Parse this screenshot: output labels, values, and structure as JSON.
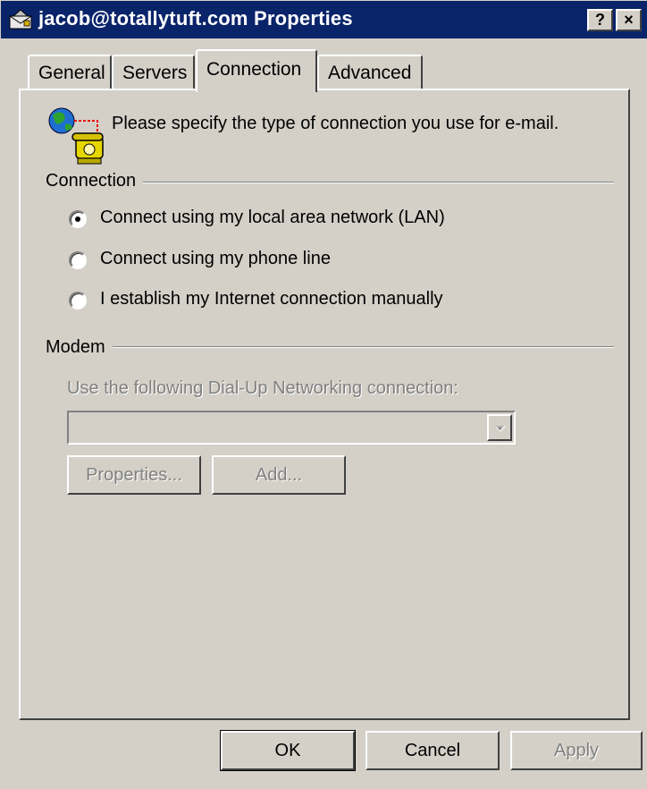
{
  "window": {
    "title": "jacob@totallytuft.com Properties",
    "help_label": "?",
    "close_label": "×"
  },
  "tabs": [
    {
      "label": "General",
      "selected": false
    },
    {
      "label": "Servers",
      "selected": false
    },
    {
      "label": "Connection",
      "selected": true
    },
    {
      "label": "Advanced",
      "selected": false
    }
  ],
  "connection_page": {
    "intro": "Please specify the type of connection you use for e-mail.",
    "connection_group": {
      "label": "Connection",
      "options": [
        {
          "label": "Connect using my local area network (LAN)",
          "checked": true
        },
        {
          "label": "Connect using my phone line",
          "checked": false
        },
        {
          "label": "I establish my Internet connection manually",
          "checked": false
        }
      ]
    },
    "modem_group": {
      "label": "Modem",
      "dialup_label": "Use the following Dial-Up Networking connection:",
      "dialup_selected": "",
      "properties_button": "Properties...",
      "add_button": "Add..."
    }
  },
  "buttons": {
    "ok": "OK",
    "cancel": "Cancel",
    "apply": "Apply"
  },
  "colors": {
    "face": "#d4d0c8",
    "titlebar": "#0a246a",
    "disabled_text": "#808080"
  },
  "icons": [
    "envelope-title-icon",
    "globe-telephone-icon",
    "radio-button",
    "dropdown-arrow-icon"
  ]
}
